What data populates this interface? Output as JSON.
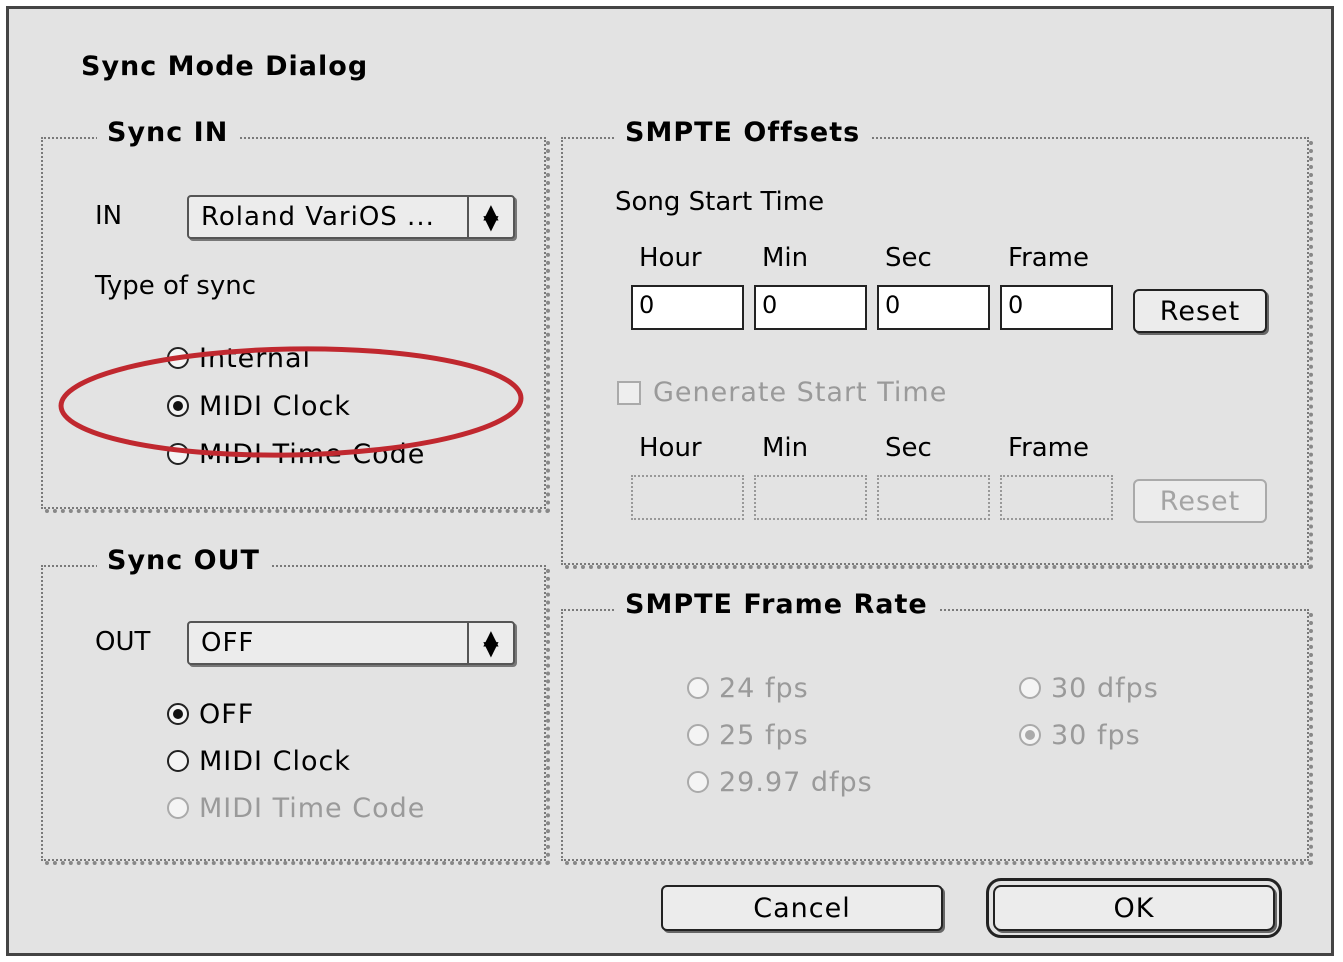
{
  "dialog": {
    "title": "Sync Mode Dialog"
  },
  "sync_in": {
    "legend": "Sync IN",
    "in_label": "IN",
    "in_value": "Roland VariOS ...",
    "type_label": "Type of sync",
    "options": [
      "Internal",
      "MIDI Clock",
      "MIDI Time Code"
    ],
    "selected": "MIDI Clock"
  },
  "sync_out": {
    "legend": "Sync OUT",
    "out_label": "OUT",
    "out_value": "OFF",
    "options": [
      "OFF",
      "MIDI Clock",
      "MIDI Time Code"
    ],
    "selected": "OFF"
  },
  "smpte_offsets": {
    "legend": "SMPTE Offsets",
    "song_start_label": "Song Start Time",
    "columns": [
      "Hour",
      "Min",
      "Sec",
      "Frame"
    ],
    "song_start_values": [
      "0",
      "0",
      "0",
      "0"
    ],
    "reset_label": "Reset",
    "generate_label": "Generate Start Time",
    "generate_checked": false,
    "generate_values": [
      "",
      "",
      "",
      ""
    ]
  },
  "frame_rate": {
    "legend": "SMPTE Frame Rate",
    "options": [
      "24 fps",
      "25 fps",
      "29.97 dfps",
      "30 dfps",
      "30 fps"
    ],
    "selected": "30 fps"
  },
  "buttons": {
    "cancel": "Cancel",
    "ok": "OK"
  },
  "colors": {
    "dialog_bg": "#e3e3e3",
    "highlight_ring": "#c0282f",
    "disabled_text": "#9a9a9a"
  },
  "icons": {
    "popup_arrows": "updown-arrows-icon"
  }
}
